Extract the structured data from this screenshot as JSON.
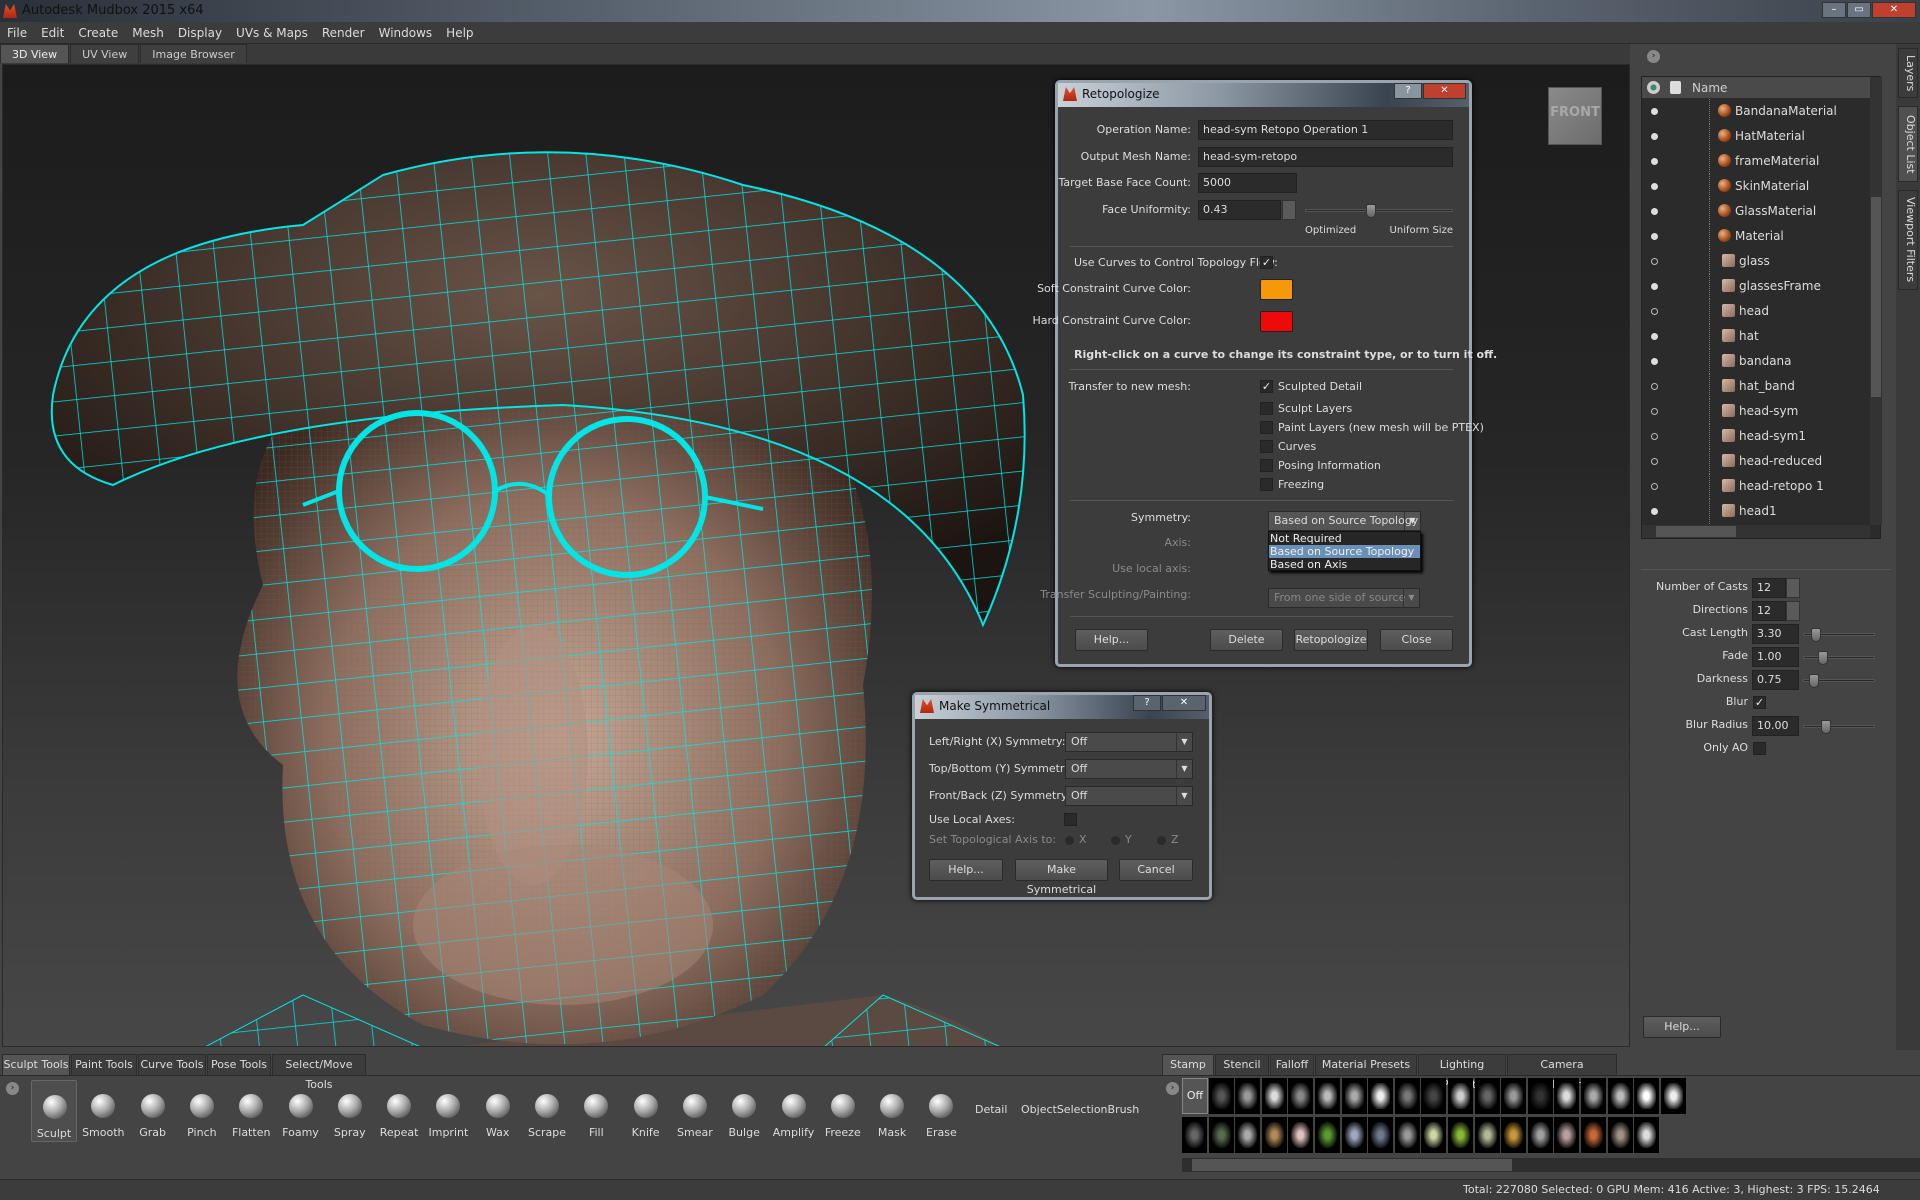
{
  "window": {
    "title": "Autodesk Mudbox 2015 x64",
    "controls": [
      "–",
      "▭",
      "✕"
    ]
  },
  "menu": [
    "File",
    "Edit",
    "Create",
    "Mesh",
    "Display",
    "UVs & Maps",
    "Render",
    "Windows",
    "Help"
  ],
  "view_tabs": [
    {
      "label": "3D View",
      "active": true
    },
    {
      "label": "UV View"
    },
    {
      "label": "Image Browser"
    }
  ],
  "viewport": {
    "view_cube_label": "FRONT",
    "wire_color": "#00e5e5"
  },
  "side_tabs": [
    "Layers",
    "Object List",
    "Viewport Filters"
  ],
  "object_list": {
    "header": "Name",
    "items": [
      {
        "name": "BandanaMaterial",
        "type": "material",
        "visible": true
      },
      {
        "name": "HatMaterial",
        "type": "material",
        "visible": true
      },
      {
        "name": "frameMaterial",
        "type": "material",
        "visible": true
      },
      {
        "name": "SkinMaterial",
        "type": "material",
        "visible": true
      },
      {
        "name": "GlassMaterial",
        "type": "material",
        "visible": true
      },
      {
        "name": "Material",
        "type": "material",
        "visible": true
      },
      {
        "name": "glass",
        "type": "mesh",
        "visible": false
      },
      {
        "name": "glassesFrame",
        "type": "mesh",
        "visible": true
      },
      {
        "name": "head",
        "type": "mesh",
        "visible": false
      },
      {
        "name": "hat",
        "type": "mesh",
        "visible": true
      },
      {
        "name": "bandana",
        "type": "mesh",
        "visible": true
      },
      {
        "name": "hat_band",
        "type": "mesh",
        "visible": false
      },
      {
        "name": "head-sym",
        "type": "mesh",
        "visible": false
      },
      {
        "name": "head-sym1",
        "type": "mesh",
        "visible": false
      },
      {
        "name": "head-reduced",
        "type": "mesh",
        "visible": false
      },
      {
        "name": "head-retopo 1",
        "type": "mesh",
        "visible": false
      },
      {
        "name": "head1",
        "type": "mesh",
        "visible": true
      }
    ]
  },
  "properties": {
    "number_of_casts": {
      "label": "Number of Casts",
      "value": "12"
    },
    "directions": {
      "label": "Directions",
      "value": "12"
    },
    "cast_length": {
      "label": "Cast Length",
      "value": "3.30",
      "slider": 0.12
    },
    "fade": {
      "label": "Fade",
      "value": "1.00",
      "slider": 0.22
    },
    "darkness": {
      "label": "Darkness",
      "value": "0.75",
      "slider": 0.08
    },
    "blur": {
      "label": "Blur",
      "checked": true
    },
    "blur_radius": {
      "label": "Blur Radius",
      "value": "10.00",
      "slider": 0.28
    },
    "only_ao": {
      "label": "Only AO",
      "checked": false
    },
    "help": "Help..."
  },
  "retopo": {
    "title": "Retopologize",
    "operation_name": {
      "label": "Operation Name:",
      "value": "head-sym Retopo Operation 1"
    },
    "output_mesh": {
      "label": "Output Mesh Name:",
      "value": "head-sym-retopo"
    },
    "target_faces": {
      "label": "Target Base Face Count:",
      "value": "5000"
    },
    "face_uniformity": {
      "label": "Face Uniformity:",
      "value": "0.43",
      "slider": 0.43,
      "min_label": "Optimized",
      "max_label": "Uniform Size"
    },
    "use_curves": {
      "label": "Use Curves to Control Topology Flow:",
      "checked": true
    },
    "soft_color": {
      "label": "Soft Constraint Curve Color:",
      "color": "#f5980a"
    },
    "hard_color": {
      "label": "Hard Constraint Curve Color:",
      "color": "#ee0a0a"
    },
    "hint": "Right-click on a curve to change its constraint type, or to turn it off.",
    "transfer_label": "Transfer to new mesh:",
    "transfer": [
      {
        "label": "Sculpted Detail",
        "checked": true
      },
      {
        "label": "Sculpt Layers",
        "checked": false
      },
      {
        "label": "Paint Layers (new mesh will be PTEX)",
        "checked": false
      },
      {
        "label": "Curves",
        "checked": false
      },
      {
        "label": "Posing Information",
        "checked": false
      },
      {
        "label": "Freezing",
        "checked": false
      }
    ],
    "symmetry": {
      "label": "Symmetry:",
      "value": "Based on Source Topology",
      "options": [
        "Not Required",
        "Based on Source Topology",
        "Based on Axis"
      ],
      "selected": 1
    },
    "axis_label": "Axis:",
    "use_local_axis_label": "Use local axis:",
    "transfer_sculpt": {
      "label": "Transfer Sculpting/Painting:",
      "value": "From one side of source"
    },
    "buttons": {
      "help": "Help...",
      "delete": "Delete",
      "retopologize": "Retopologize",
      "close": "Close"
    },
    "title_help": "?",
    "title_close": "✕"
  },
  "symm": {
    "title": "Make Symmetrical",
    "lr": {
      "label": "Left/Right (X) Symmetry:",
      "value": "Off"
    },
    "tb": {
      "label": "Top/Bottom (Y) Symmetry:",
      "value": "Off"
    },
    "fb": {
      "label": "Front/Back (Z) Symmetry:",
      "value": "Off"
    },
    "local_axes": {
      "label": "Use Local Axes:",
      "checked": false
    },
    "topo_axis": {
      "label": "Set Topological Axis to:",
      "options": [
        "X",
        "Y",
        "Z"
      ]
    },
    "buttons": {
      "help": "Help...",
      "make": "Make Symmetrical",
      "cancel": "Cancel"
    },
    "title_help": "?",
    "title_close": "✕"
  },
  "tool_tabs": [
    {
      "label": "Sculpt Tools",
      "active": true
    },
    {
      "label": "Paint Tools"
    },
    {
      "label": "Curve Tools"
    },
    {
      "label": "Pose Tools"
    },
    {
      "label": "Select/Move Tools"
    }
  ],
  "tools": [
    "Sculpt",
    "Smooth",
    "Grab",
    "Pinch",
    "Flatten",
    "Foamy",
    "Spray",
    "Repeat",
    "Imprint",
    "Wax",
    "Scrape",
    "Fill",
    "Knife",
    "Smear",
    "Bulge",
    "Amplify",
    "Freeze",
    "Mask",
    "Erase"
  ],
  "tools_text": [
    "Detail",
    "ObjectSelectionBrush"
  ],
  "stamp_tabs": [
    {
      "label": "Stamp",
      "active": true
    },
    {
      "label": "Stencil"
    },
    {
      "label": "Falloff"
    },
    {
      "label": "Material Presets"
    },
    {
      "label": "Lighting Presets"
    },
    {
      "label": "Camera Bookmarks"
    }
  ],
  "stamp_off": "Off",
  "stamp_colors": [
    "#555",
    "#999",
    "#ddd",
    "#888",
    "#bbb",
    "#aaa",
    "#eee",
    "#777",
    "#444",
    "#ccc",
    "#666",
    "#999",
    "#333",
    "#ddd",
    "#aaa",
    "#bbb",
    "#fff",
    "#eee",
    "#666",
    "#5a6a50",
    "#aaa",
    "#b08a58",
    "#e0c0c0",
    "#5a9a30",
    "#a0a8c0",
    "#707890",
    "#999",
    "#c8d8a0",
    "#88b838",
    "#b0b898",
    "#c89838",
    "#a0a0a0",
    "#b8a0a0",
    "#c86838",
    "#a09088",
    "#ddd"
  ],
  "status": "Total: 227080  Selected: 0 GPU Mem: 416  Active: 3, Highest: 3  FPS: 15.2464"
}
